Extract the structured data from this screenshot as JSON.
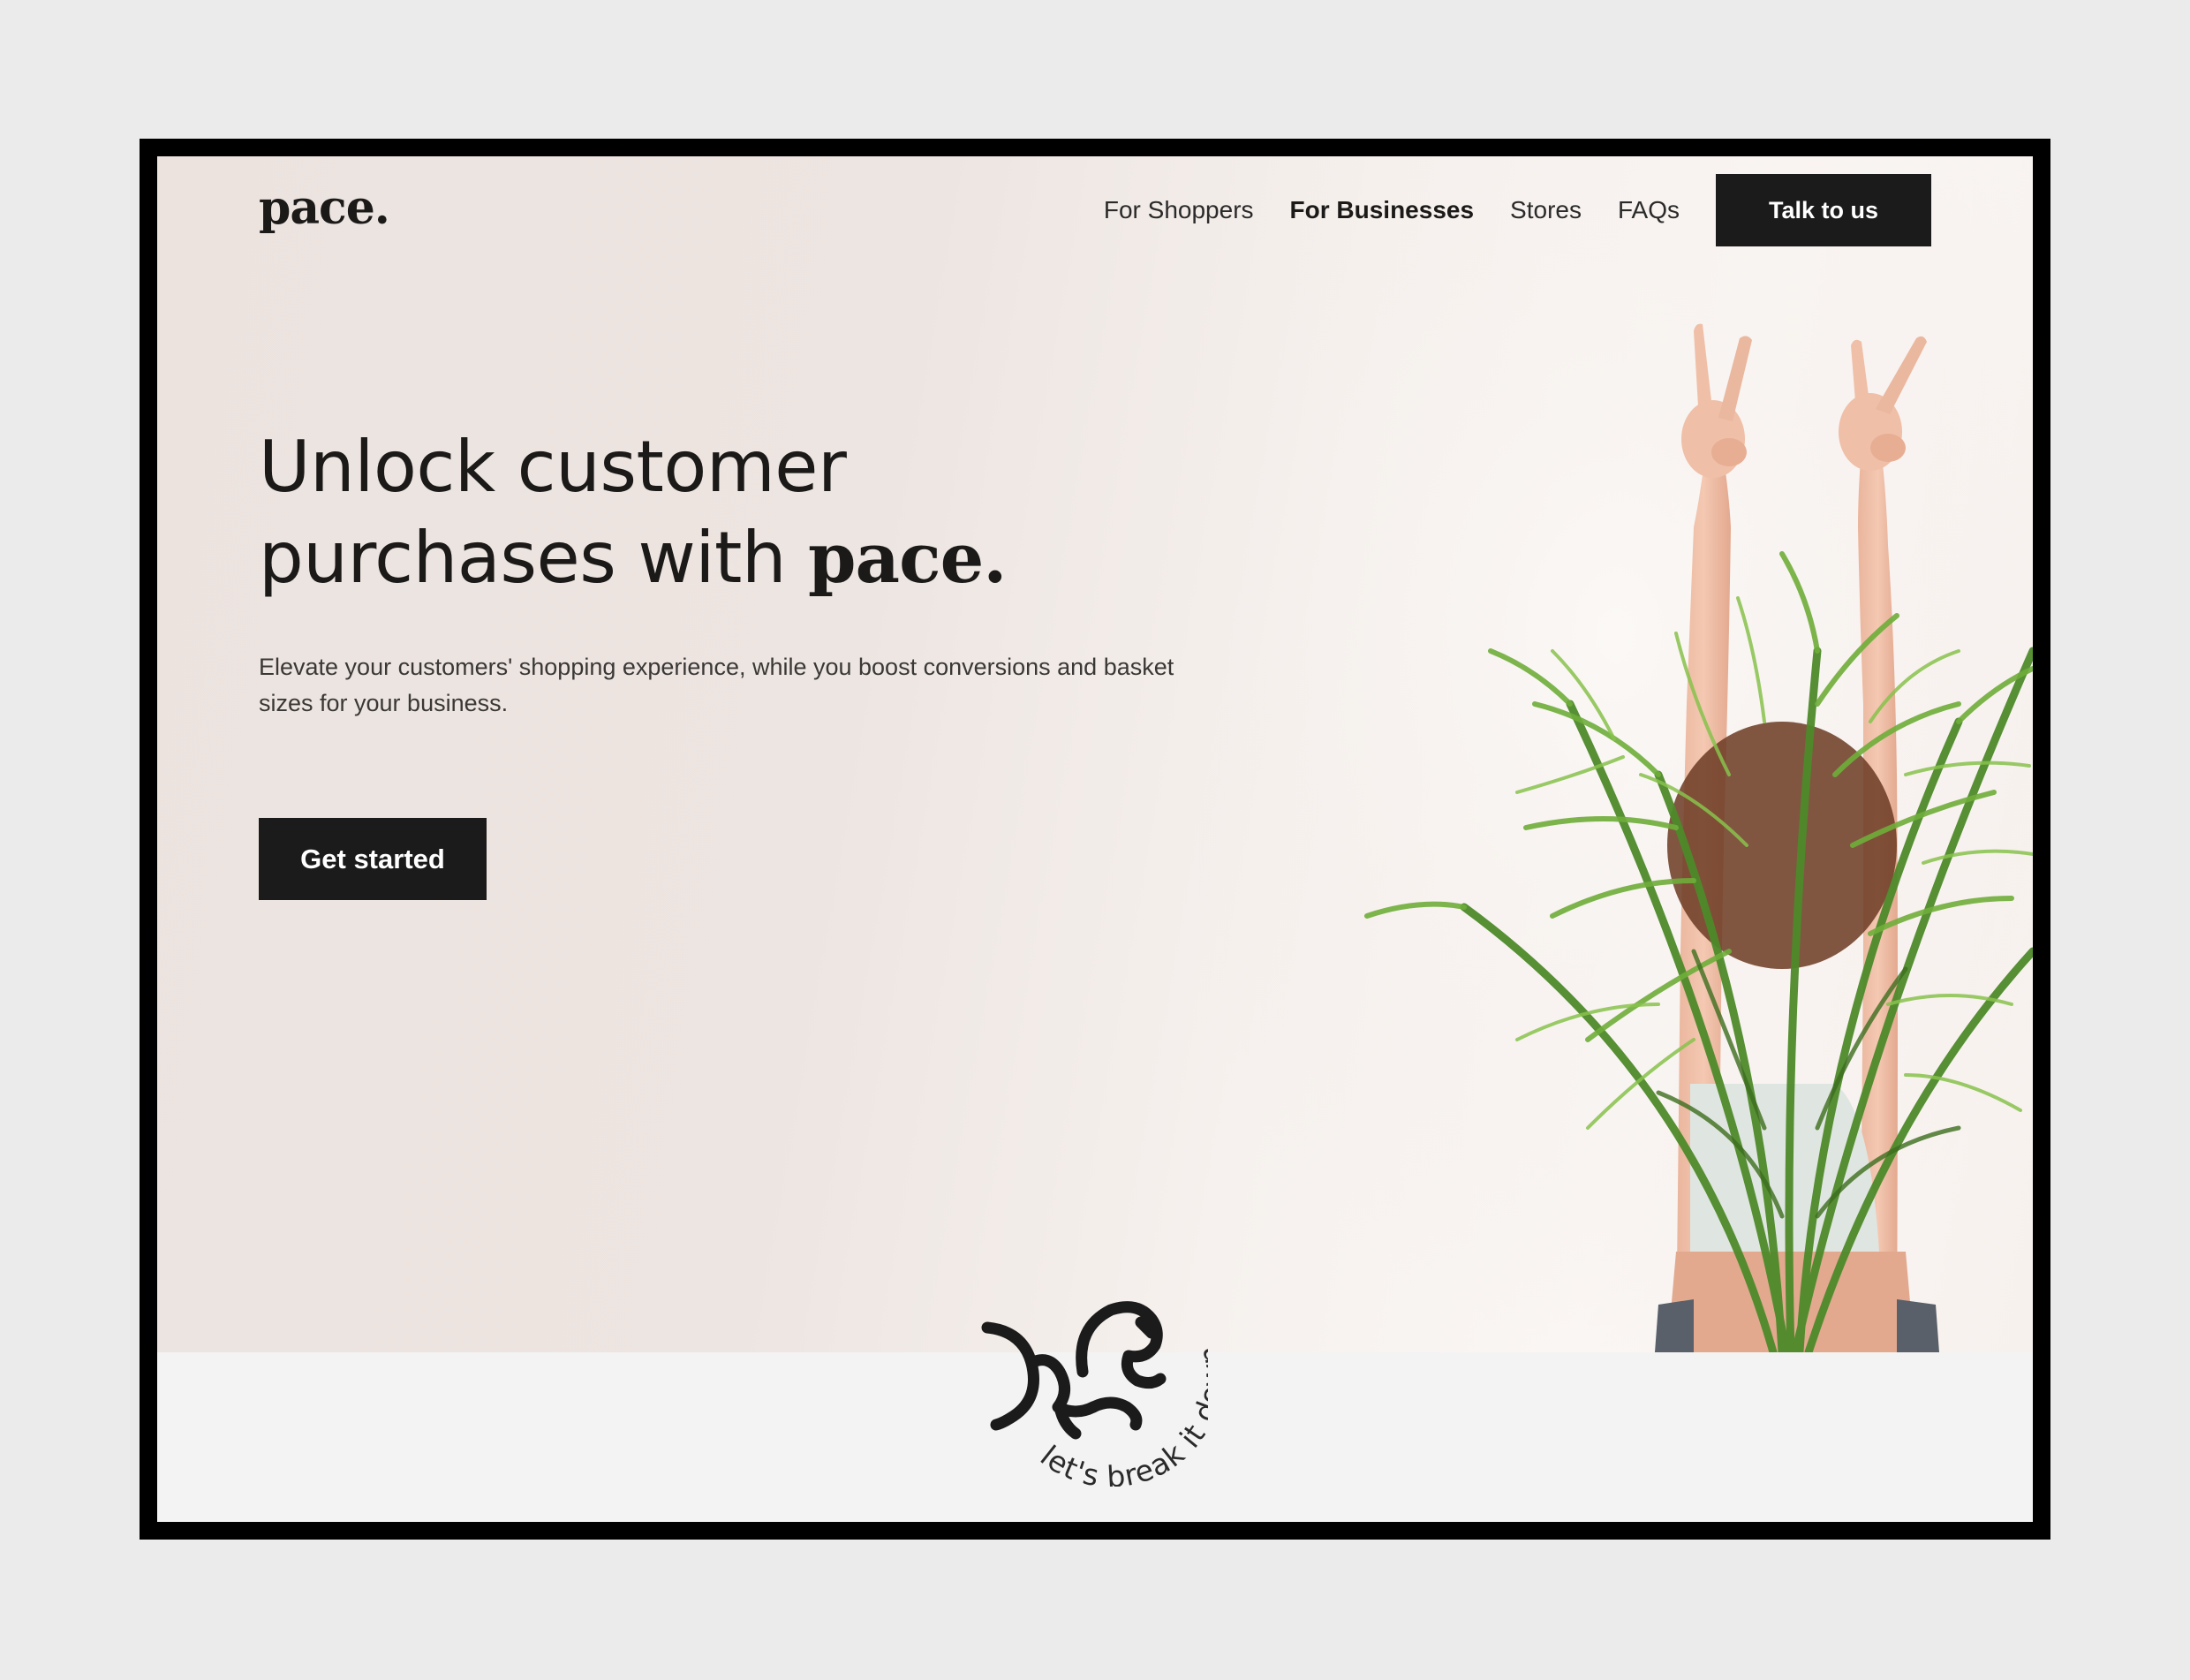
{
  "header": {
    "logo": "pace.",
    "nav": [
      {
        "label": "For Shoppers",
        "active": false
      },
      {
        "label": "For Businesses",
        "active": true
      },
      {
        "label": "Stores",
        "active": false
      },
      {
        "label": "FAQs",
        "active": false
      }
    ],
    "cta_label": "Talk to us"
  },
  "hero": {
    "headline_line1": "Unlock customer",
    "headline_line2": "purchases with",
    "headline_brand": "pace.",
    "subtext": "Elevate your customers' shopping experience, while you boost conversions and basket sizes for your business.",
    "cta_label": "Get started",
    "image_description_icon": "plant-with-peace-hands-photo"
  },
  "badge": {
    "text": "let's break it down",
    "icon": "horse-logo-icon"
  },
  "colors": {
    "button_bg": "#1b1b1b",
    "text_primary": "#1b1a19",
    "hero_bg": "#ece3df",
    "section_bg": "#f3f3f3"
  }
}
